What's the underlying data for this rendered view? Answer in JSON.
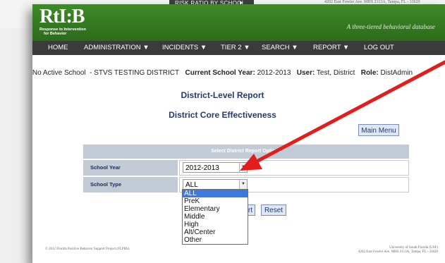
{
  "background": {
    "menu_label": "RISK RATIO BY SCHOOL",
    "address": "4202 East Fowler Ave. MHS 2113A, Tampa, FL - 33620"
  },
  "header": {
    "logo": "RtI:B",
    "logo_sub_1": "Response to Intervention",
    "logo_sub_2": "for Behavior",
    "tagline": "A three-tiered behavioral database"
  },
  "nav": [
    {
      "label": "HOME"
    },
    {
      "label": "ADMINISTRATION ▼"
    },
    {
      "label": "INCIDENTS ▼"
    },
    {
      "label": "TIER 2 ▼"
    },
    {
      "label": "SEARCH ▼"
    },
    {
      "label": "REPORT ▼"
    },
    {
      "label": "LOG OUT"
    }
  ],
  "info": {
    "school": "No Active School",
    "district": "- STVS TESTING DISTRICT",
    "year_label": "Current School Year:",
    "year_value": "2012-2013",
    "user_label": "User:",
    "user_value": "Test, District",
    "role_label": "Role:",
    "role_value": "DistAdmin"
  },
  "titles": {
    "report": "District-Level Report",
    "subreport": "District Core Effectiveness"
  },
  "main_menu_button": "Main Menu",
  "options": {
    "header": "Select District Report Options",
    "school_year_label": "School Year",
    "school_year_value": "2012-2013",
    "school_type_label": "School Type",
    "school_type_value": "ALL",
    "school_type_options": [
      "ALL",
      "PreK",
      "Elementary",
      "Middle",
      "High",
      "Alt/Center",
      "Other"
    ],
    "selected_index": 0
  },
  "buttons": {
    "submit_partial": "rt",
    "reset": "Reset"
  },
  "footer": {
    "left": "© 2012 Florida Positive Behavior Support Project (FLPBS)",
    "right_1": "University of South Florida (USF)",
    "right_2": "4202 East Fowler Ave. MHS 2113A, Tampa, FL - 33620"
  },
  "colors": {
    "header_green": "#2f7222",
    "nav_dark": "#3b3b3b",
    "title_blue": "#243a6b",
    "annotation_arrow": "#e31c1c"
  }
}
